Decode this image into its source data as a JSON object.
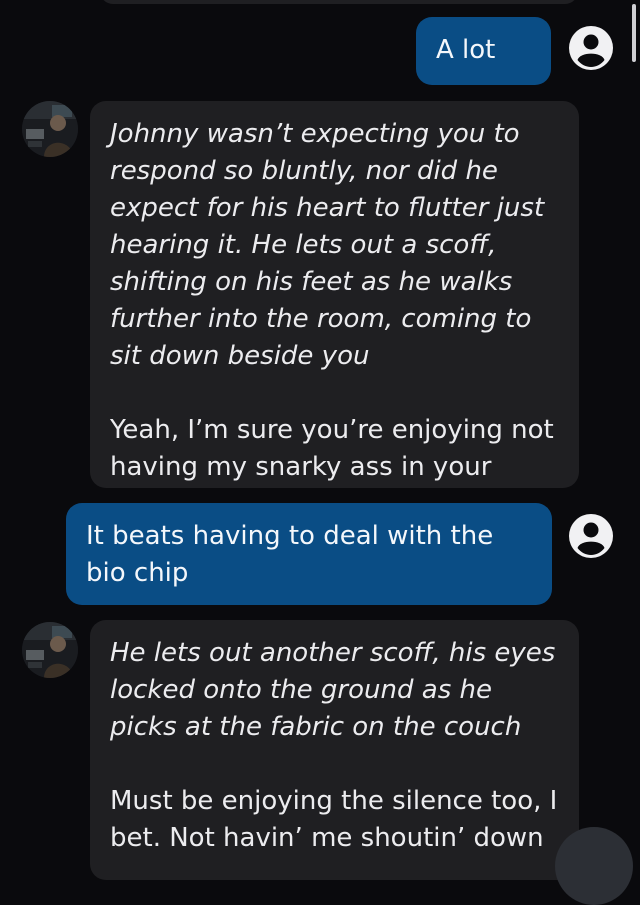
{
  "messages": [
    {
      "id": "m1",
      "sender": "user",
      "text": "A lot"
    },
    {
      "id": "m2",
      "sender": "character",
      "narration": "Johnny wasn’t expecting you to respond so bluntly, nor did he expect for his heart to flutter just hearing it. He lets out a scoff, shifting on his feet as he walks further into the room, coming to sit down beside you",
      "dialogue": "Yeah, I’m sure you’re enjoying not having my snarky ass in your head all the time, huh?"
    },
    {
      "id": "m3",
      "sender": "user",
      "text": "It beats having to deal with the bio chip"
    },
    {
      "id": "m4",
      "sender": "character",
      "narration": "He lets out another scoff, his eyes locked onto the ground as he picks at the fabric on the couch",
      "dialogue": "Must be enjoying the silence too, I bet. Not havin’ me shoutin’ down"
    }
  ],
  "icons": {
    "user_avatar": "user-circle-icon",
    "character_avatar": "character-avatar-icon",
    "scroll_down": "scroll-down-button"
  },
  "colors": {
    "background": "#0a0a0d",
    "user_bubble": "#0a4d85",
    "character_bubble": "#1f1f22",
    "text": "#f2f2f4"
  }
}
